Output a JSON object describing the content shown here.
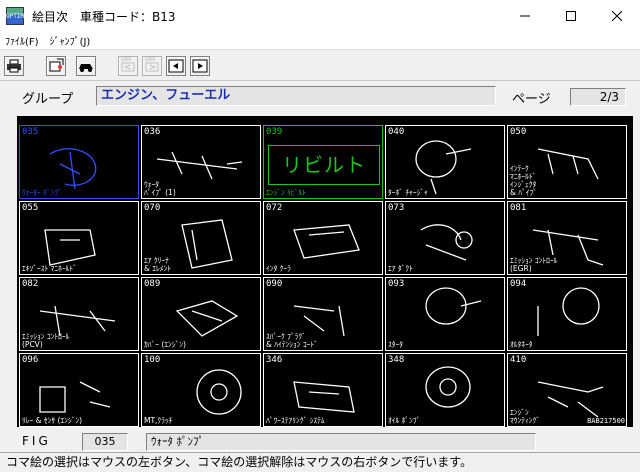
{
  "window": {
    "title": "絵目次　車種コード：B13",
    "app_icon_text": "OPTIM"
  },
  "menu": {
    "file": "ﾌｧｲﾙ(F)",
    "jump": "ｼﾞｬﾝﾌﾟ(J)"
  },
  "toolbar": {
    "grp_label_1": "GRP",
    "grp_label_2": "GRP"
  },
  "group": {
    "label": "グループ",
    "value": "エンジン、フューエル"
  },
  "page": {
    "label": "ページ",
    "value": "2/3"
  },
  "illustrations": [
    {
      "code": "035",
      "name": "ｳｫｰﾀｰ ﾎﾟﾝﾌﾟ",
      "selected": true
    },
    {
      "code": "036",
      "name": "ｳｫｰﾀ\nﾊﾟｲﾌﾟ (1)"
    },
    {
      "code": "039",
      "name": "ｴﾝｼﾞﾝ ﾘﾋﾞﾙﾄ",
      "rebuilt_label": "リビルト"
    },
    {
      "code": "040",
      "name": "ﾀｰﾎﾞ ﾁｬｰｼﾞｬ"
    },
    {
      "code": "050",
      "name": "ｲﾝﾃｰｸ\nﾏﾆﾎｰﾙﾄﾞ\nｲﾝｼﾞｪｸﾀ\n& ﾊﾟｲﾌﾟ"
    },
    {
      "code": "055",
      "name": "ｴｷｿﾞｰｽﾄ ﾏﾆﾎｰﾙﾄﾞ"
    },
    {
      "code": "070",
      "name": "ｴｱ ｸﾘｰﾅ\n& ｴﾚﾒﾝﾄ"
    },
    {
      "code": "072",
      "name": "ｲﾝﾀ ｸｰﾗ"
    },
    {
      "code": "073",
      "name": "ｴｱ ﾀﾞｸﾄ"
    },
    {
      "code": "081",
      "name": "ｴﾐｯｼｮﾝ ｺﾝﾄﾛｰﾙ\n(EGR)"
    },
    {
      "code": "082",
      "name": "ｴﾐｯｼｮﾝ ｺﾝﾄﾛｰﾙ\n(PCV)"
    },
    {
      "code": "089",
      "name": "ｶﾊﾞｰ (ｴﾝｼﾞﾝ)"
    },
    {
      "code": "090",
      "name": "ｽﾊﾟｰｸ ﾌﾟﾗｸﾞ\n& ﾊｲﾃﾝｼｮﾝ ｺｰﾄﾞ"
    },
    {
      "code": "093",
      "name": "ｽﾀｰﾀ"
    },
    {
      "code": "094",
      "name": "ｵﾙﾀﾈｰﾀ"
    },
    {
      "code": "096",
      "name": "ﾘﾚｰ & ｾﾝｻ (ｴﾝｼﾞﾝ)"
    },
    {
      "code": "100",
      "name": "MT,ｸﾗｯﾁ"
    },
    {
      "code": "346",
      "name": "ﾊﾟﾜｰｽﾃｱﾘﾝｸﾞ ｼｽﾃﾑ"
    },
    {
      "code": "348",
      "name": "ｵｲﾙ ﾎﾟﾝﾌﾟ"
    },
    {
      "code": "410",
      "name": "ｴﾝｼﾞﾝ\nﾏｳﾝﾃｨﾝｸﾞ",
      "stamp": "BAB217500"
    }
  ],
  "fig": {
    "label": "FIG",
    "code": "035",
    "name": "ｳｫｰﾀ ﾎﾟﾝﾌﾟ"
  },
  "status": {
    "text": "コマ絵の選択はマウスの左ボタン、コマ絵の選択解除はマウスの右ボタンで行います。"
  }
}
